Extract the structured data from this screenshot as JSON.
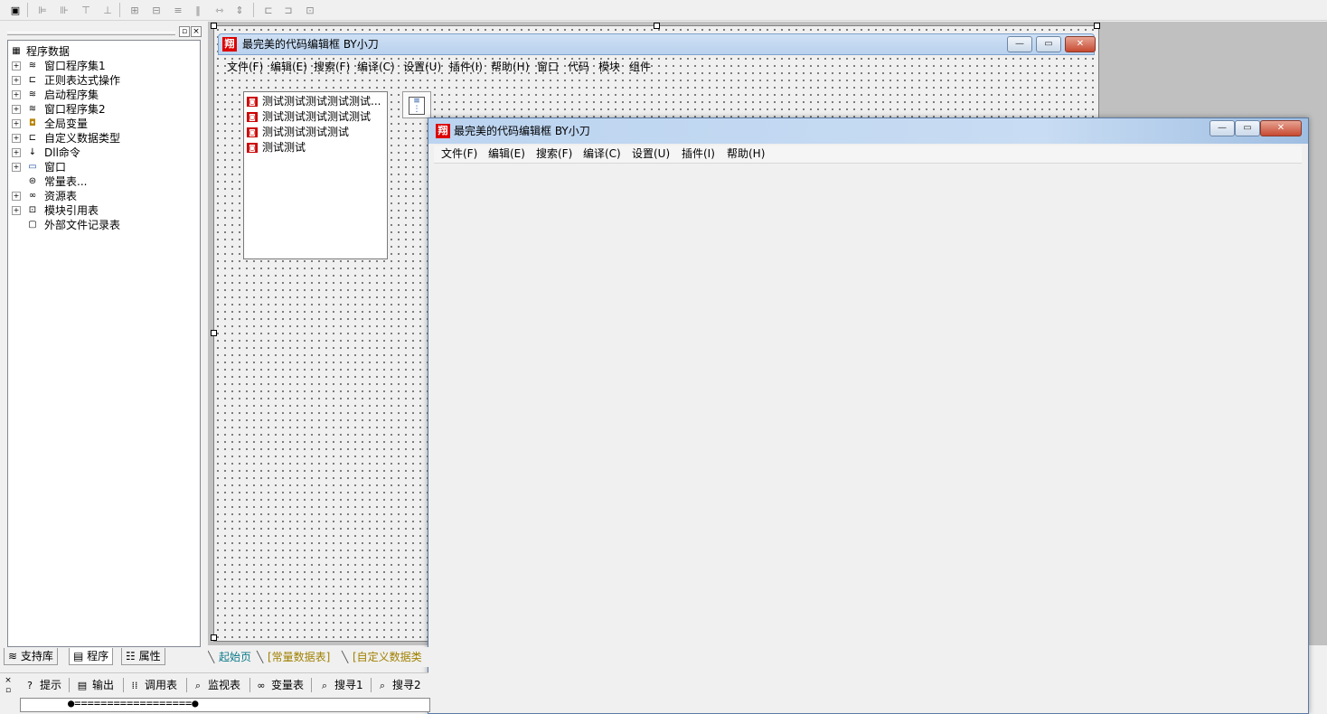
{
  "toolbar": {
    "icons": [
      "form-icon",
      "align-left-icon",
      "align-center-icon",
      "align-right-icon",
      "align-top-icon",
      "align-middle-icon",
      "align-bottom-icon",
      "center-h-icon",
      "center-v-icon",
      "space-h-icon",
      "space-v-icon",
      "same-width-icon",
      "same-height-icon",
      "same-size-icon"
    ]
  },
  "left_panel": {
    "tree": [
      {
        "label": "程序数据",
        "icon": "program-data-icon",
        "glyph": "▦"
      },
      {
        "label": "窗口程序集1",
        "icon": "assembly-icon",
        "glyph": "≋"
      },
      {
        "label": "正则表达式操作",
        "icon": "class-icon",
        "glyph": "⊏"
      },
      {
        "label": "启动程序集",
        "icon": "assembly-icon",
        "glyph": "≋"
      },
      {
        "label": "窗口程序集2",
        "icon": "assembly-icon",
        "glyph": "≋"
      },
      {
        "label": "全局变量",
        "icon": "global-variable-icon",
        "glyph": "◘"
      },
      {
        "label": "自定义数据类型",
        "icon": "datatype-icon",
        "glyph": "⊏"
      },
      {
        "label": "Dll命令",
        "icon": "dll-icon",
        "glyph": "↓"
      },
      {
        "label": "窗口",
        "icon": "window-icon",
        "glyph": "▭"
      },
      {
        "label": "常量表...",
        "icon": "constant-icon",
        "glyph": "⊜"
      },
      {
        "label": "资源表",
        "icon": "resource-icon",
        "glyph": "∞"
      },
      {
        "label": "模块引用表",
        "icon": "module-icon",
        "glyph": "⊡"
      },
      {
        "label": "外部文件记录表",
        "icon": "file-icon",
        "glyph": "▢"
      }
    ],
    "tabs": [
      {
        "label": "支持库",
        "icon": "library-icon",
        "glyph": "≋"
      },
      {
        "label": "程序",
        "icon": "program-icon",
        "glyph": "▤"
      },
      {
        "label": "属性",
        "icon": "property-icon",
        "glyph": "☷"
      }
    ]
  },
  "design_window": {
    "app_badge": "翔",
    "title": "最完美的代码编辑框 BY小刀",
    "menu": [
      "文件(F)",
      "编辑(E)",
      "搜索(F)",
      "编译(C)",
      "设置(U)",
      "插件(I)",
      "帮助(H)",
      "窗口",
      "代码",
      "模块",
      "组件"
    ],
    "list_items": [
      "测试测试测试测试测试...",
      "测试测试测试测试测试",
      "测试测试测试测试",
      "测试测试"
    ]
  },
  "run_window": {
    "app_badge": "翔",
    "title": "最完美的代码编辑框 BY小刀",
    "menu": [
      "文件(F)",
      "编辑(E)",
      "搜索(F)",
      "编译(C)",
      "设置(U)",
      "插件(I)",
      "帮助(H)"
    ]
  },
  "doc_tabs": [
    "起始页",
    "[常量数据表]",
    "[自定义数据类"
  ],
  "bottom_tabs": [
    {
      "label": "提示",
      "icon": "hint-icon",
      "glyph": "?"
    },
    {
      "label": "输出",
      "icon": "output-icon",
      "glyph": "▤"
    },
    {
      "label": "调用表",
      "icon": "callstack-icon",
      "glyph": "⁞⁞"
    },
    {
      "label": "监视表",
      "icon": "watch-icon",
      "glyph": "⌕"
    },
    {
      "label": "变量表",
      "icon": "variables-icon",
      "glyph": "∞"
    },
    {
      "label": "搜寻1",
      "icon": "search-results-icon",
      "glyph": "⌕"
    },
    {
      "label": "搜寻2",
      "icon": "search-results-icon",
      "glyph": "⌕"
    }
  ],
  "output": {
    "progress_text": "●==================●"
  },
  "colors": {
    "accent": "#0078d7",
    "title_active": "#b9d1ee",
    "close_red": "#c74a32",
    "badge_red": "#dd0000",
    "list_icon_red": "#cc0000"
  }
}
